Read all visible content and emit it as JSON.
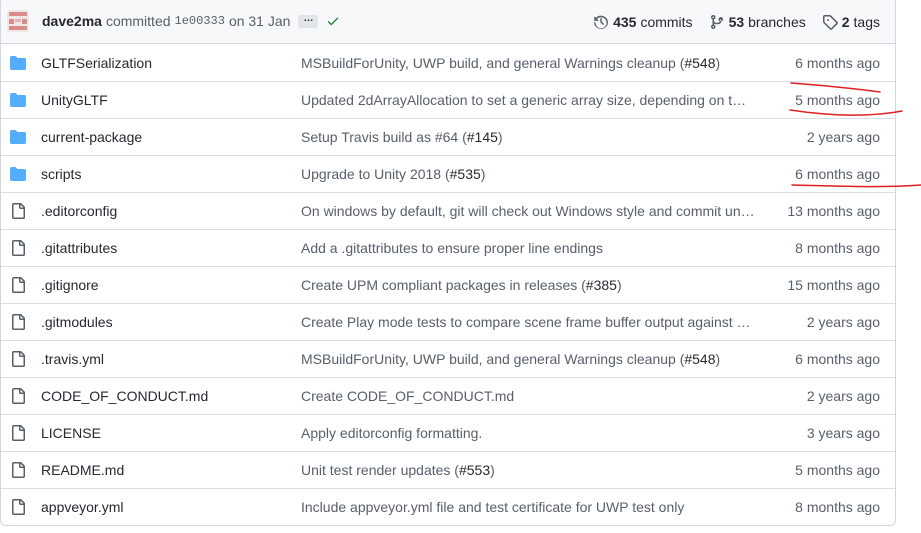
{
  "commit_bar": {
    "author": "dave2ma",
    "action": "committed",
    "sha": "1e00333",
    "date": "on 31 Jan",
    "ellipsis_label": "…",
    "commits_count": "435",
    "commits_label": "commits",
    "branches_count": "53",
    "branches_label": "branches",
    "tags_count": "2",
    "tags_label": "tags"
  },
  "files": [
    {
      "type": "folder",
      "name": "GLTFSerialization",
      "message": "MSBuildForUnity, UWP build, and general Warnings cleanup (",
      "pr": "#548",
      "close": ")",
      "age": "6 months ago"
    },
    {
      "type": "folder",
      "name": "UnityGLTF",
      "message": "Updated 2dArrayAllocation to set a generic array size, depending on t…",
      "pr": "",
      "close": "",
      "age": "5 months ago"
    },
    {
      "type": "folder",
      "name": "current-package",
      "message": "Setup Travis build as #64 (",
      "pr": "#145",
      "close": ")",
      "age": "2 years ago"
    },
    {
      "type": "folder",
      "name": "scripts",
      "message": "Upgrade to Unity 2018 (",
      "pr": "#535",
      "close": ")",
      "age": "6 months ago"
    },
    {
      "type": "file",
      "name": ".editorconfig",
      "message": "On windows by default, git will check out Windows style and commit un…",
      "pr": "",
      "close": "",
      "age": "13 months ago"
    },
    {
      "type": "file",
      "name": ".gitattributes",
      "message": "Add a .gitattributes to ensure proper line endings",
      "pr": "",
      "close": "",
      "age": "8 months ago"
    },
    {
      "type": "file",
      "name": ".gitignore",
      "message": "Create UPM compliant packages in releases (",
      "pr": "#385",
      "close": ")",
      "age": "15 months ago"
    },
    {
      "type": "file",
      "name": ".gitmodules",
      "message": "Create Play mode tests to compare scene frame buffer output against m…",
      "pr": "",
      "close": "",
      "age": "2 years ago"
    },
    {
      "type": "file",
      "name": ".travis.yml",
      "message": "MSBuildForUnity, UWP build, and general Warnings cleanup (",
      "pr": "#548",
      "close": ")",
      "age": "6 months ago"
    },
    {
      "type": "file",
      "name": "CODE_OF_CONDUCT.md",
      "message": "Create CODE_OF_CONDUCT.md",
      "pr": "",
      "close": "",
      "age": "2 years ago"
    },
    {
      "type": "file",
      "name": "LICENSE",
      "message": "Apply editorconfig formatting.",
      "pr": "",
      "close": "",
      "age": "3 years ago"
    },
    {
      "type": "file",
      "name": "README.md",
      "message": "Unit test render updates (",
      "pr": "#553",
      "close": ")",
      "age": "5 months ago"
    },
    {
      "type": "file",
      "name": "appveyor.yml",
      "message": "Include appveyor.yml file and test certificate for UWP test only",
      "pr": "",
      "close": "",
      "age": "8 months ago"
    }
  ],
  "colors": {
    "folder_icon": "#54aeff",
    "file_icon": "#57606a",
    "check": "#1a7f37",
    "annotation": "#e02020"
  }
}
